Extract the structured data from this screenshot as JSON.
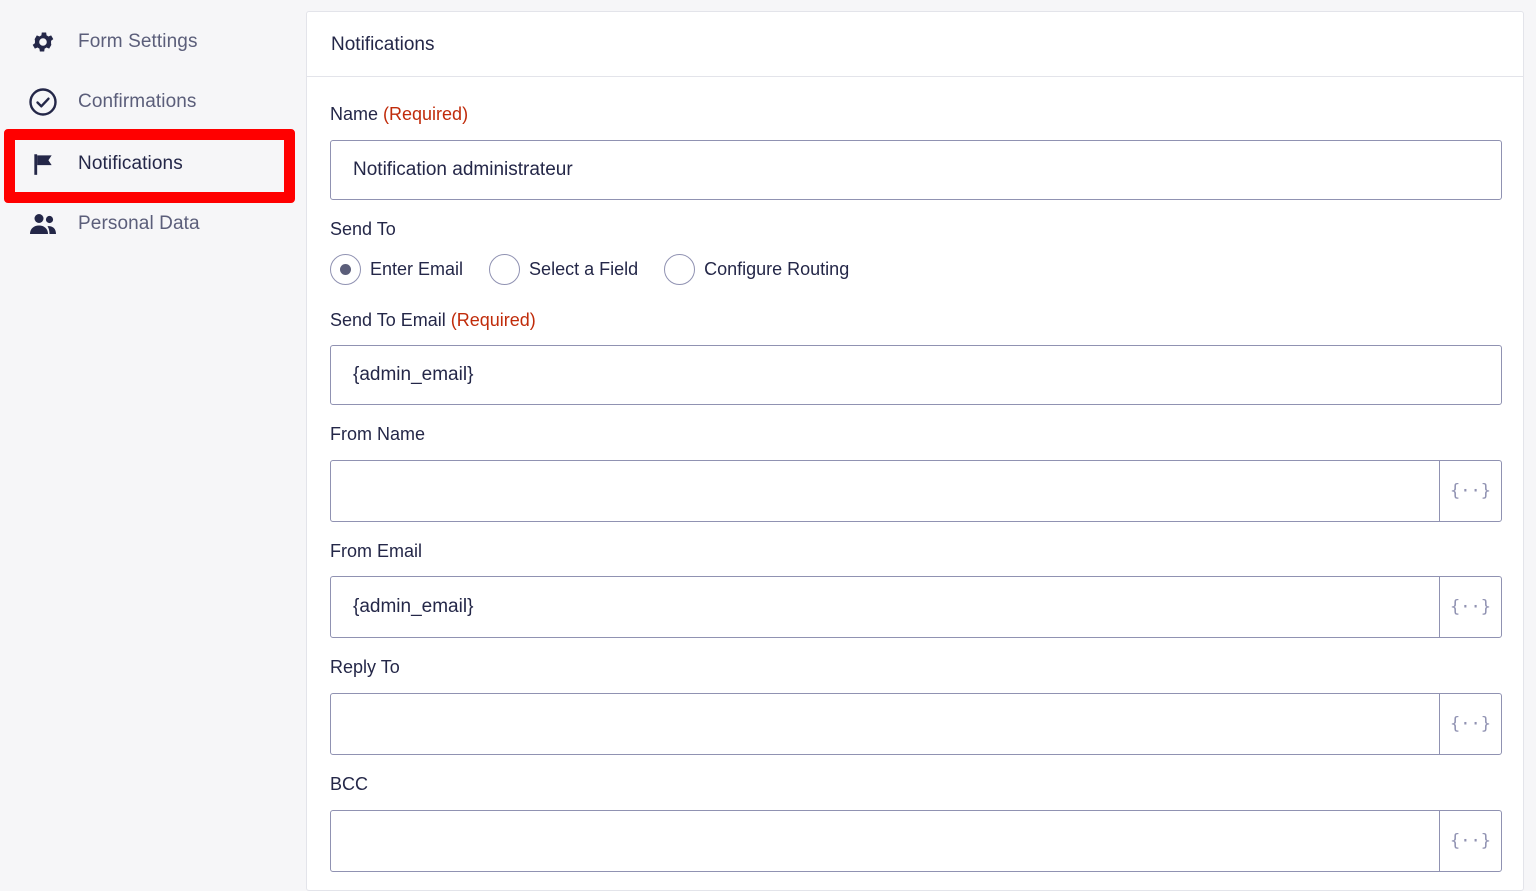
{
  "sidebar": {
    "items": [
      {
        "label": "Form Settings",
        "icon": "gear-icon"
      },
      {
        "label": "Confirmations",
        "icon": "check-circle-icon"
      },
      {
        "label": "Notifications",
        "icon": "flag-icon",
        "active": true
      },
      {
        "label": "Personal Data",
        "icon": "users-icon"
      }
    ]
  },
  "panel": {
    "title": "Notifications",
    "name_label": "Name",
    "required_text": "(Required)",
    "name_value": "Notification administrateur",
    "send_to_label": "Send To",
    "send_to_options": [
      "Enter Email",
      "Select a Field",
      "Configure Routing"
    ],
    "send_to_selected": "Enter Email",
    "send_to_email_label": "Send To Email",
    "send_to_email_value": "{admin_email}",
    "from_name_label": "From Name",
    "from_name_value": "",
    "from_email_label": "From Email",
    "from_email_value": "{admin_email}",
    "reply_to_label": "Reply To",
    "reply_to_value": "",
    "bcc_label": "BCC",
    "bcc_value": "",
    "merge_tag_glyph": "{··}"
  },
  "colors": {
    "required": "#c02b0a",
    "highlight": "#ff0000",
    "text": "#242748",
    "muted": "#5b5e7a",
    "border": "#9092b2"
  }
}
